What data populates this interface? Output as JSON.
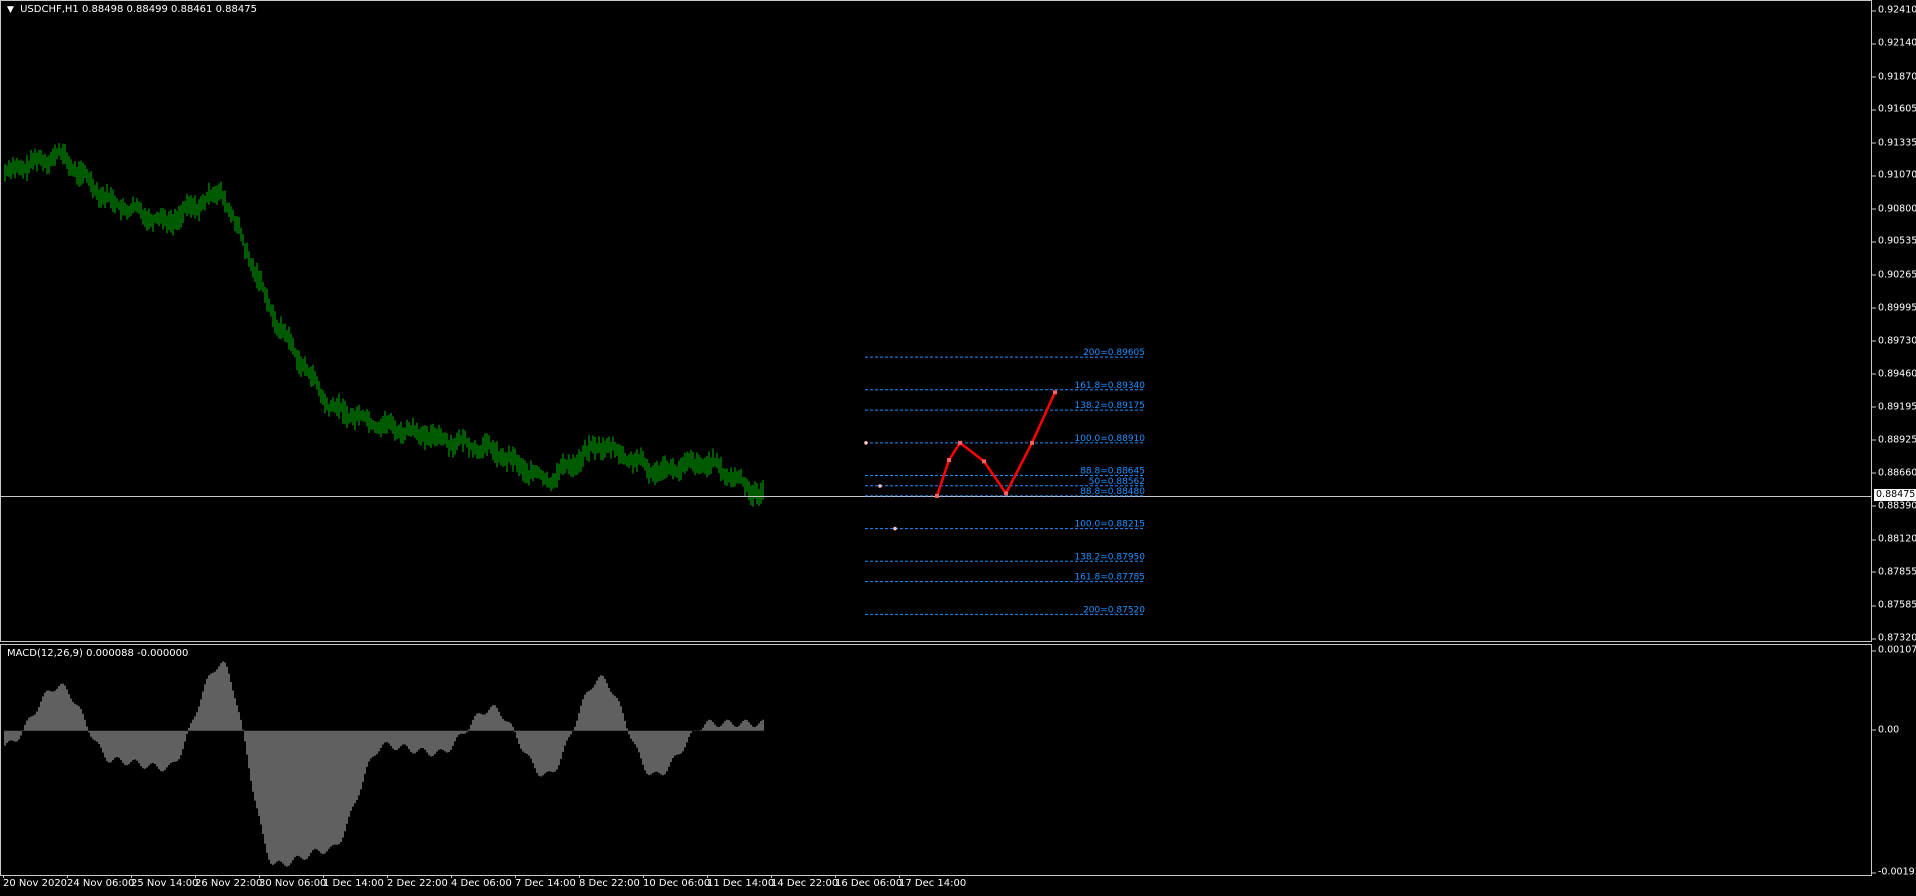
{
  "symbol_label": "USDCHF,H1",
  "ohlc": "0.88498 0.88499 0.88461 0.88475",
  "current_price": "0.88475",
  "price_axis": [
    "0.92410",
    "0.92140",
    "0.91870",
    "0.91605",
    "0.91335",
    "0.91070",
    "0.90800",
    "0.90535",
    "0.90265",
    "0.89995",
    "0.89730",
    "0.89460",
    "0.89195",
    "0.88925",
    "0.88660",
    "0.88390",
    "0.88120",
    "0.87855",
    "0.87585",
    "0.87320"
  ],
  "fibo_upper": [
    {
      "label": "200=0.89605",
      "price": 0.89605
    },
    {
      "label": "161.8=0.89340",
      "price": 0.8934
    },
    {
      "label": "138.2=0.89175",
      "price": 0.89175
    },
    {
      "label": "100.0=0.88910",
      "price": 0.8891
    },
    {
      "label": "88.8=0.88645",
      "price": 0.88645
    },
    {
      "label": "50=0.88562",
      "price": 0.88562
    },
    {
      "label": "88.8=0.88480",
      "price": 0.8848
    }
  ],
  "fibo_lower": [
    {
      "label": "100.0=0.88215",
      "price": 0.88215
    },
    {
      "label": "138.2=0.87950",
      "price": 0.8795
    },
    {
      "label": "161.8=0.87785",
      "price": 0.87785
    },
    {
      "label": "200=0.87520",
      "price": 0.8752
    }
  ],
  "macd_label": "MACD(12,26,9) 0.000088 -0.000000",
  "macd_axis": [
    "0.001073",
    "0.00",
    "-0.001912"
  ],
  "time_axis": [
    "20 Nov 2020",
    "24 Nov 06:00",
    "25 Nov 14:00",
    "26 Nov 22:00",
    "30 Nov 06:00",
    "1 Dec 14:00",
    "2 Dec 22:00",
    "4 Dec 06:00",
    "7 Dec 14:00",
    "8 Dec 22:00",
    "10 Dec 06:00",
    "11 Dec 14:00",
    "14 Dec 22:00",
    "16 Dec 06:00",
    "17 Dec 14:00"
  ],
  "colors": {
    "candles": "#00b400",
    "fibo": "#1e90ff",
    "pattern": "#ff0000",
    "grid": "#c8c8c8",
    "macd": "#c0c0c0"
  },
  "chart_data": [
    {
      "type": "line",
      "title": "USDCHF,H1",
      "ylim": [
        0.8732,
        0.9241
      ],
      "x": [
        "20 Nov 2020",
        "24 Nov 06:00",
        "25 Nov 14:00",
        "26 Nov 22:00",
        "30 Nov 06:00",
        "1 Dec 14:00",
        "2 Dec 22:00",
        "4 Dec 06:00",
        "7 Dec 14:00",
        "8 Dec 22:00",
        "10 Dec 06:00",
        "11 Dec 14:00",
        "14 Dec 22:00",
        "16 Dec 06:00",
        "17 Dec 14:00"
      ],
      "series": [
        {
          "values": [
            0.911,
            0.9125,
            0.9085,
            0.907,
            0.9095,
            0.899,
            0.892,
            0.8905,
            0.8895,
            0.8885,
            0.886,
            0.889,
            0.8868,
            0.8875,
            0.8848
          ]
        }
      ],
      "projection": {
        "values": [
          0.8848,
          0.8877,
          0.8891,
          0.8876,
          0.885,
          0.8891,
          0.8932
        ]
      }
    },
    {
      "type": "bar",
      "title": "MACD(12,26,9)",
      "ylim": [
        -0.001912,
        0.001073
      ],
      "x": [
        "20 Nov 2020",
        "24 Nov 06:00",
        "25 Nov 14:00",
        "26 Nov 22:00",
        "30 Nov 06:00",
        "1 Dec 14:00",
        "2 Dec 22:00",
        "4 Dec 06:00",
        "7 Dec 14:00",
        "8 Dec 22:00",
        "10 Dec 06:00",
        "11 Dec 14:00",
        "14 Dec 22:00",
        "16 Dec 06:00",
        "17 Dec 14:00"
      ],
      "values": [
        -0.0002,
        0.0006,
        -0.0004,
        -0.0005,
        0.0009,
        -0.0018,
        -0.0016,
        -0.0002,
        -0.0003,
        0.0003,
        -0.0006,
        0.0007,
        -0.0006,
        0.0001,
        0.0001
      ]
    }
  ]
}
